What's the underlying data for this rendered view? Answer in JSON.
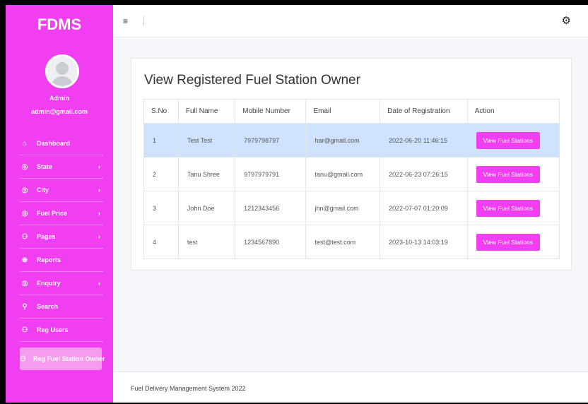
{
  "brand": "FDMS",
  "user": {
    "name": "Admin",
    "email": "admin@gmail.com"
  },
  "nav": [
    {
      "label": "Dashboard",
      "icon": "dashboard-icon",
      "glyph": "⌂",
      "chevron": false
    },
    {
      "label": "State",
      "icon": "circle-icon",
      "glyph": "◎",
      "chevron": true
    },
    {
      "label": "City",
      "icon": "circle-icon",
      "glyph": "◎",
      "chevron": true
    },
    {
      "label": "Fuel Price",
      "icon": "circle-icon",
      "glyph": "◎",
      "chevron": true
    },
    {
      "label": "Pages",
      "icon": "user-icon",
      "glyph": "⚇",
      "chevron": true
    },
    {
      "label": "Reports",
      "icon": "reports-icon",
      "glyph": "⊕",
      "chevron": false
    },
    {
      "label": "Enquiry",
      "icon": "circle-icon",
      "glyph": "◎",
      "chevron": true
    },
    {
      "label": "Search",
      "icon": "search-icon",
      "glyph": "⚲",
      "chevron": false
    },
    {
      "label": "Reg Users",
      "icon": "user-icon",
      "glyph": "⚇",
      "chevron": false
    },
    {
      "label": "Reg Fuel Station Owner",
      "icon": "user-icon",
      "glyph": "⚇",
      "chevron": false,
      "active": true
    }
  ],
  "chevron_glyph": "›",
  "topbar": {
    "menu_glyph": "≡",
    "settings_glyph": "⚙"
  },
  "page": {
    "title": "View Registered Fuel Station Owner",
    "table": {
      "headers": [
        "S.No",
        "Full Name",
        "Mobile Number",
        "Email",
        "Date of Registration",
        "Action"
      ],
      "rows": [
        {
          "sno": "1",
          "name": "Test Test",
          "mobile": "7979798797",
          "email": "har@gmail.com",
          "date": "2022-06-20 11:46:15",
          "action": "View Fuel Stations"
        },
        {
          "sno": "2",
          "name": "Tanu Shree",
          "mobile": "9797979791",
          "email": "tanu@gmail.com",
          "date": "2022-06-23 07:26:15",
          "action": "View Fuel Stations"
        },
        {
          "sno": "3",
          "name": "John Doe",
          "mobile": "1212343456",
          "email": "jhn@gmail.com",
          "date": "2022-07-07 01:20:09",
          "action": "View Fuel Stations"
        },
        {
          "sno": "4",
          "name": "test",
          "mobile": "1234567890",
          "email": "test@test.com",
          "date": "2023-10-13 14:03:19",
          "action": "View Fuel Stations"
        }
      ]
    }
  },
  "footer": "Fuel Delivery Management System 2022",
  "colors": {
    "brand": "#f03ef0",
    "highlight_row": "#cfe2ff",
    "active_nav": "#f59cf0"
  }
}
